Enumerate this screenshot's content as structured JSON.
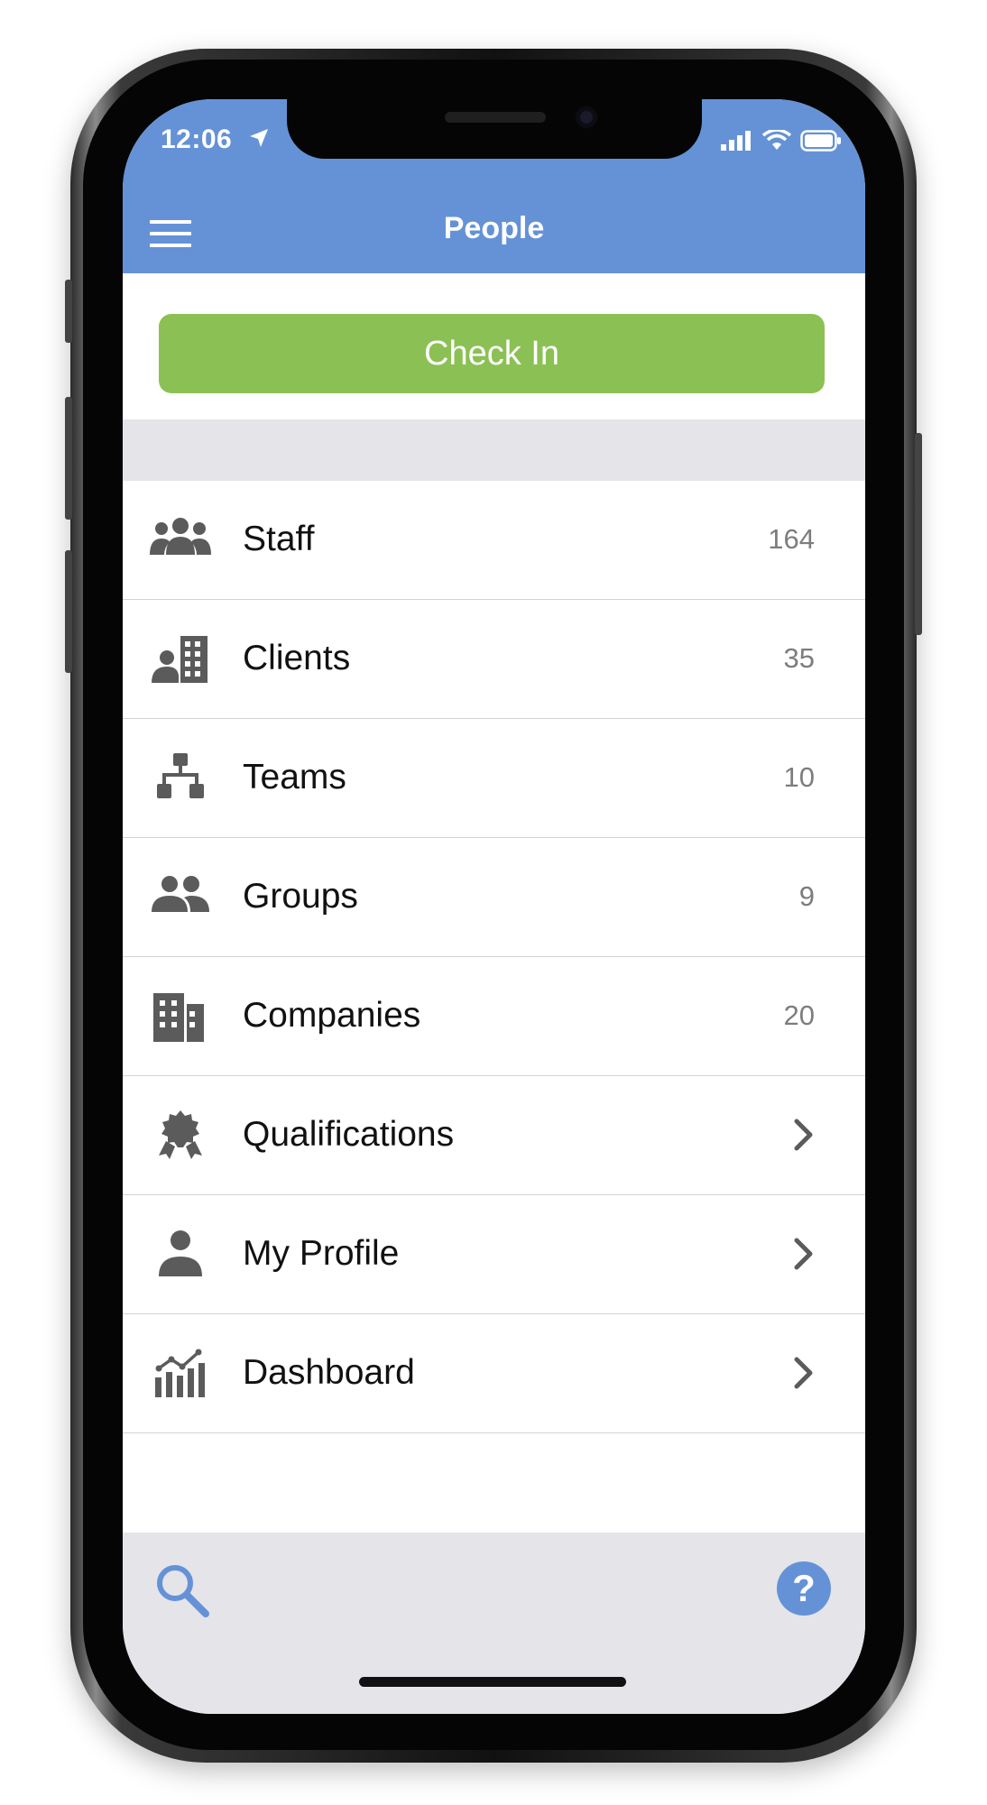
{
  "status_bar": {
    "time": "12:06"
  },
  "header": {
    "title": "People"
  },
  "check_in": {
    "label": "Check In"
  },
  "list": {
    "items": [
      {
        "label": "Staff",
        "count": "164",
        "icon": "staff-icon"
      },
      {
        "label": "Clients",
        "count": "35",
        "icon": "clients-icon"
      },
      {
        "label": "Teams",
        "count": "10",
        "icon": "teams-icon"
      },
      {
        "label": "Groups",
        "count": "9",
        "icon": "groups-icon"
      },
      {
        "label": "Companies",
        "count": "20",
        "icon": "companies-icon"
      },
      {
        "label": "Qualifications",
        "icon": "qualifications-icon"
      },
      {
        "label": "My Profile",
        "icon": "profile-icon"
      },
      {
        "label": "Dashboard",
        "icon": "dashboard-icon"
      }
    ]
  },
  "bottom_bar": {
    "help_label": "?"
  },
  "colors": {
    "header": "#6592d6",
    "check_in": "#8bc154",
    "icon_gray": "#5b5b5b",
    "band": "#e4e4e9"
  }
}
